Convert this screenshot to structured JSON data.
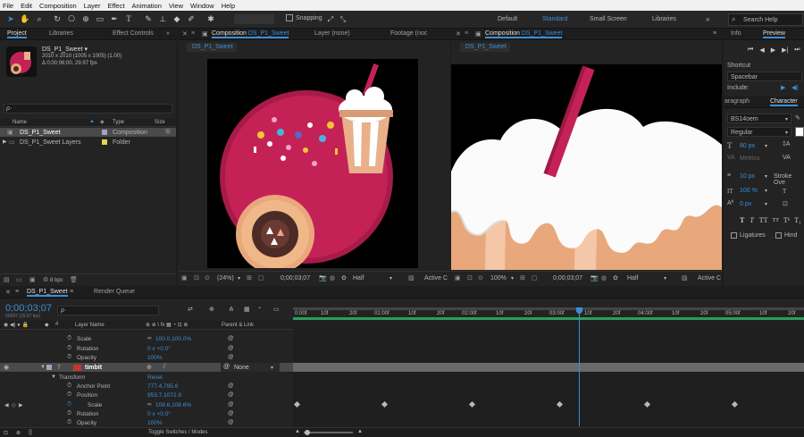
{
  "menu": [
    "File",
    "Edit",
    "Composition",
    "Layer",
    "Effect",
    "Animation",
    "View",
    "Window",
    "Help"
  ],
  "toolbar": {
    "snapping": "Snapping",
    "workspaces": [
      "Default",
      "Standard",
      "Small Screen",
      "Libraries"
    ],
    "search_placeholder": "Search Help"
  },
  "project": {
    "tab": "Project",
    "tab2": "Libraries",
    "tab3": "Effect Controls",
    "item_name": "DS_P1_Sweet ▾",
    "item_dims": "2010 x 2010 (1005 x 1005) (1.00)",
    "item_dur": "Δ 0;00;06;00, 29.97 fps",
    "search": "ρ·",
    "col_name": "Name",
    "col_type": "Type",
    "col_size": "Size",
    "rows": [
      {
        "name": "DS_P1_Sweet",
        "type": "Composition"
      },
      {
        "name": "DS_P1_Sweet Layers",
        "type": "Folder"
      }
    ],
    "bpc": "8 bpc"
  },
  "comp": {
    "tab": "Composition",
    "tab_name": "DS_P1_Sweet",
    "tab_layer": "Layer (none)",
    "tab_footage": "Footage (noc",
    "flow": "DS_P1_Sweet",
    "zoom": "(24%)",
    "time": "0;00;03;07",
    "quality": "Half",
    "camera": "Active C"
  },
  "comp2": {
    "tab": "Composition",
    "tab_name": "DS_P1_Sweet",
    "flow": "DS_P1_Sweet",
    "zoom": "100%",
    "time": "0;00;03;07",
    "quality": "Half",
    "camera": "Active C"
  },
  "right": {
    "tab_info": "Info",
    "tab_preview": "Preview",
    "shortcut_label": "Shortcut",
    "shortcut": "Spacebar",
    "include": "Include:",
    "tab_paragraph": "aragraph",
    "tab_character": "Character",
    "font": "BS14oem",
    "style": "Regular",
    "font_size": "80 px",
    "metrics": "Metrics",
    "tracking": "10 px",
    "stroke": "Stroke Ove",
    "vscale": "100 %",
    "baseline": "0 px",
    "ligatures": "Ligatures",
    "hindi": "Hind"
  },
  "timeline": {
    "tab": "DS_P1_Sweet",
    "tab2": "Render Queue",
    "time": "0;00;03;07",
    "fps": "00097 (29.97 fps)",
    "search": "ρ·",
    "col_layer": "Layer Name",
    "col_parent": "Parent & Link",
    "ticks": [
      "0:00f",
      "10f",
      "20f",
      "01:00f",
      "10f",
      "20f",
      "02:00f",
      "10f",
      "20f",
      "03:00f",
      "10f",
      "20f",
      "04:00f",
      "10f",
      "20f",
      "05:00f",
      "10f",
      "20f"
    ],
    "rows": [
      {
        "label": "Scale",
        "value": "100.0,100.0%"
      },
      {
        "label": "Rotation",
        "value": "0 x +0.0°"
      },
      {
        "label": "Opacity",
        "value": "100%"
      }
    ],
    "layer": {
      "num": "7",
      "name": "timbit",
      "parent": "None"
    },
    "transform": {
      "label": "Transform",
      "reset": "Reset"
    },
    "rows2": [
      {
        "label": "Anchor Point",
        "value": "777.4,795.6"
      },
      {
        "label": "Position",
        "value": "953.7,1072.9"
      },
      {
        "label": "Scale",
        "value": "108.6,108.6%"
      },
      {
        "label": "Rotation",
        "value": "0 x +0.0°"
      },
      {
        "label": "Opacity",
        "value": "100%"
      }
    ],
    "toggle": "Toggle Switches / Modes"
  },
  "colors": {
    "accent": "#3b8ed6",
    "ball": "#c42257",
    "cookie": "#e9a77c",
    "cookie_inner": "#4c2b27"
  }
}
